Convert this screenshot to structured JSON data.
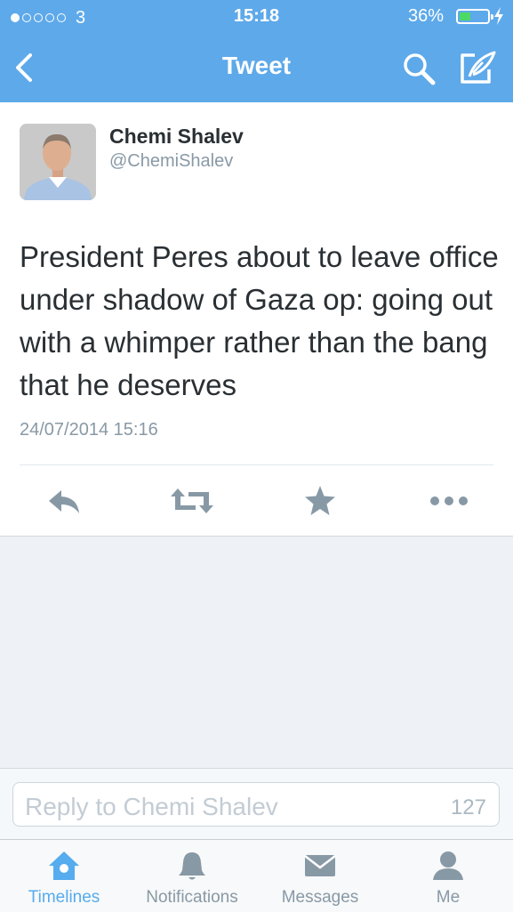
{
  "status_bar": {
    "carrier": "3",
    "time": "15:18",
    "battery": "36%"
  },
  "nav": {
    "title": "Tweet"
  },
  "tweet": {
    "author_name": "Chemi Shalev",
    "author_handle": "@ChemiShalev",
    "text": "President Peres about to leave office under shadow of Gaza op: going out with a whimper rather than the bang that he deserves",
    "timestamp": "24/07/2014 15:16"
  },
  "reply": {
    "placeholder": "Reply to Chemi Shalev",
    "char_count": "127"
  },
  "tabs": [
    {
      "label": "Timelines",
      "icon": "home-icon",
      "active": true
    },
    {
      "label": "Notifications",
      "icon": "bell-icon"
    },
    {
      "label": "Messages",
      "icon": "envelope-icon"
    },
    {
      "label": "Me",
      "icon": "person-icon"
    }
  ],
  "colors": {
    "accent": "#55acee",
    "header": "#5ea9ea",
    "battery": "#4cd964",
    "action_icon": "#8899a6"
  }
}
